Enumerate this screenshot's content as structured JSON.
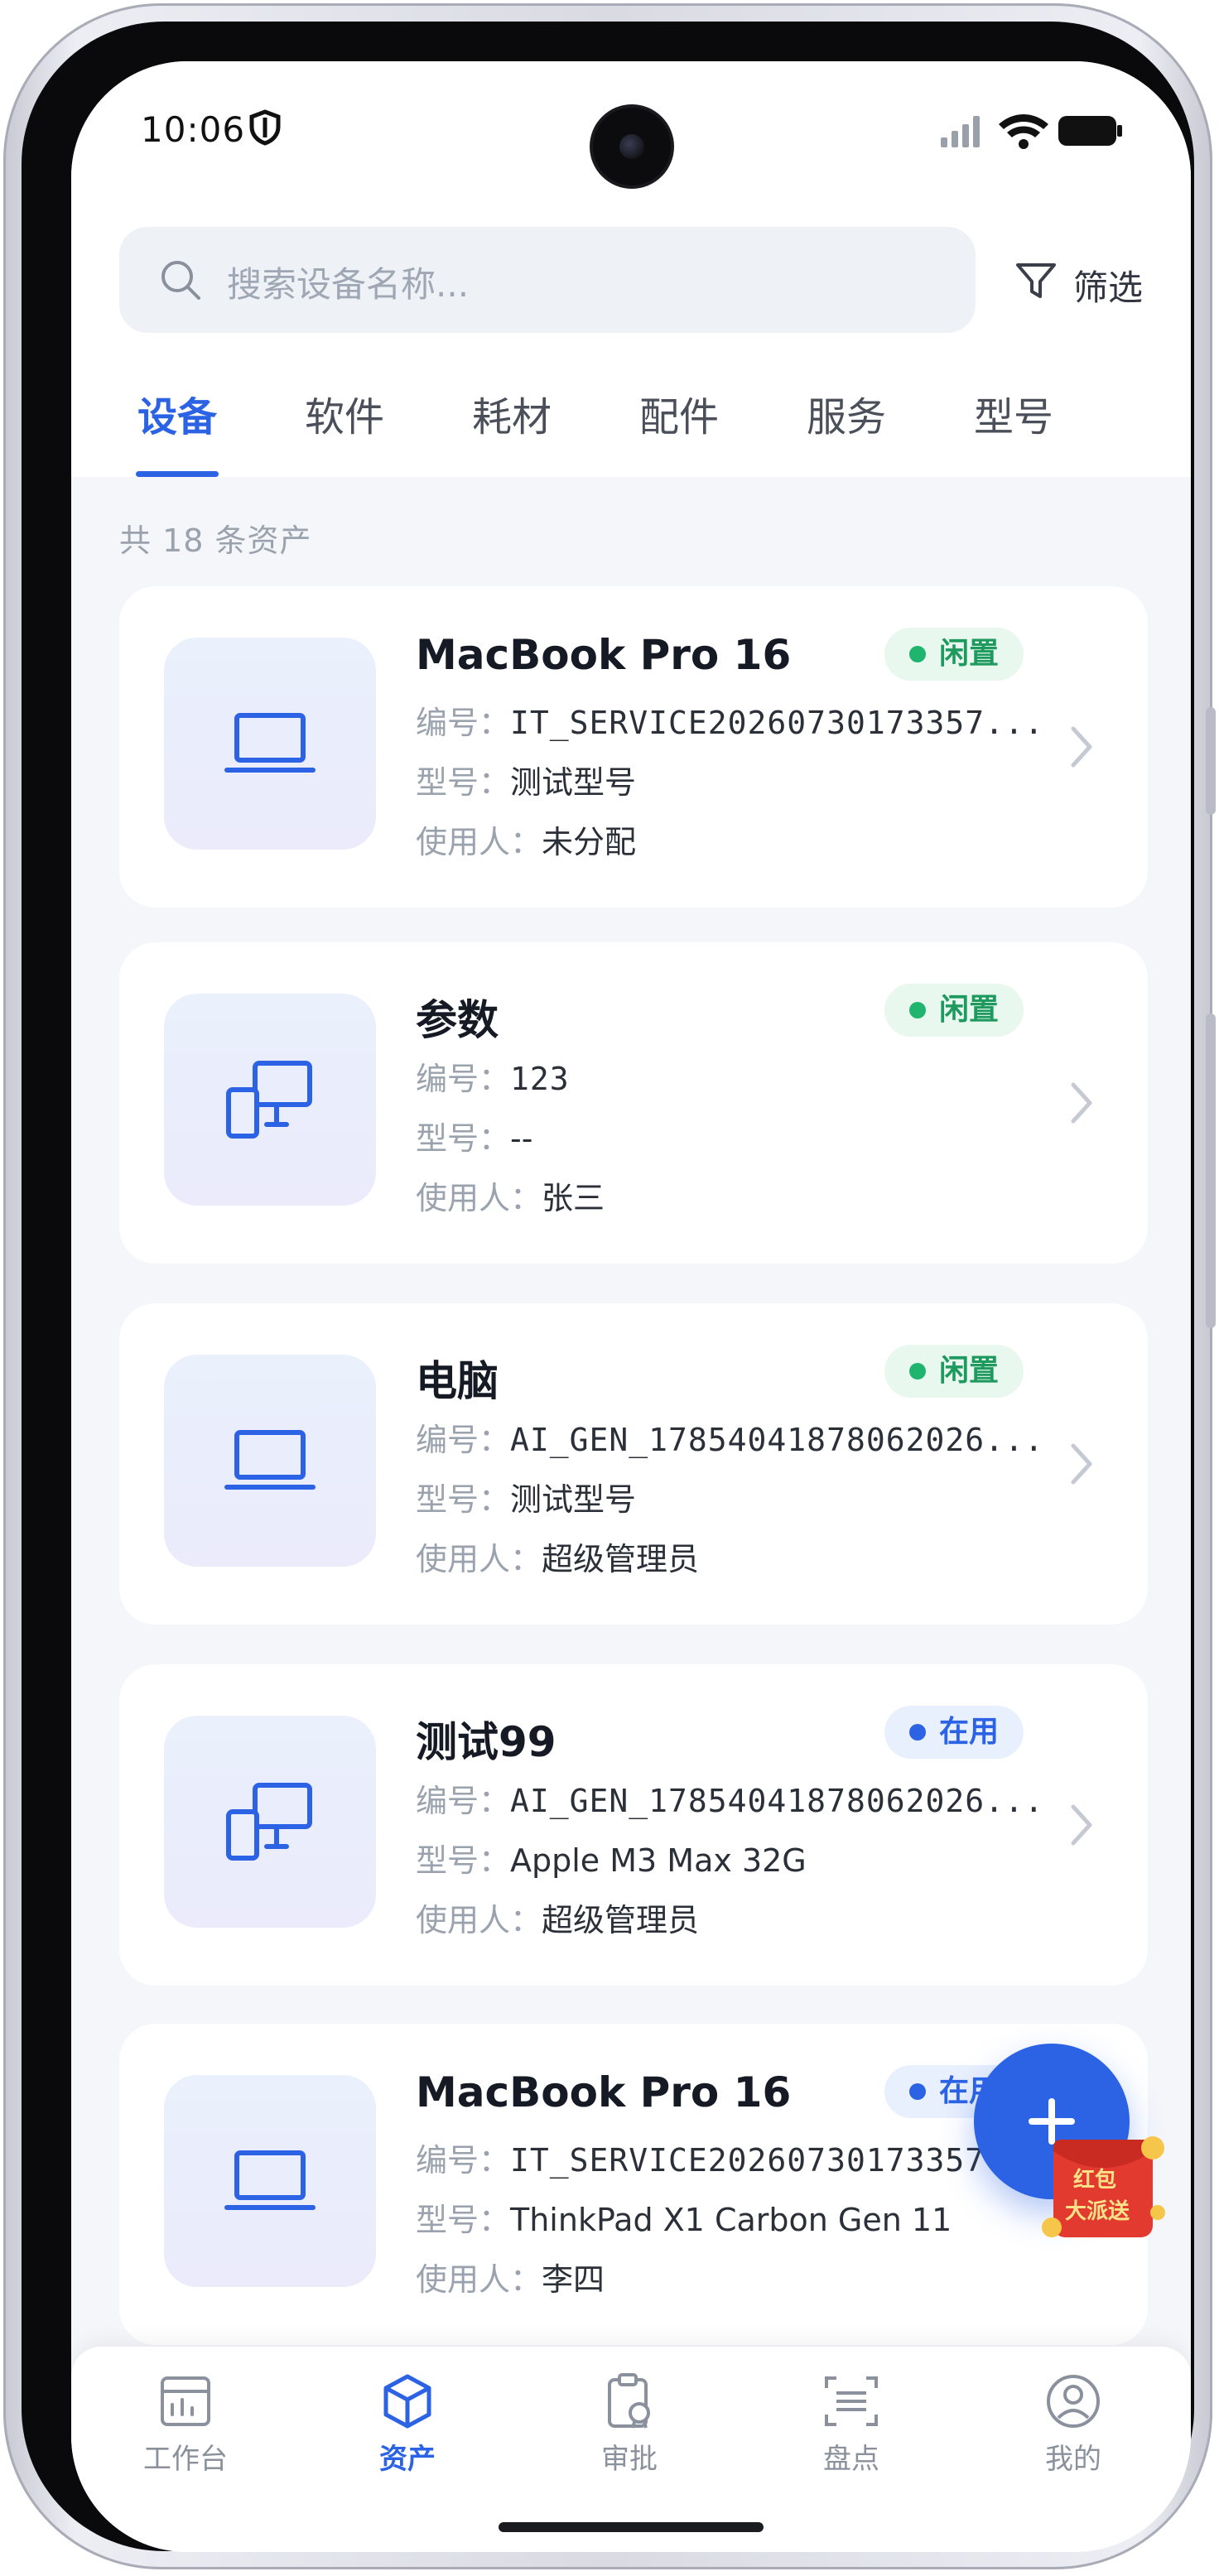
{
  "status_bar": {
    "time": "10:06"
  },
  "search": {
    "placeholder": "搜索设备名称..."
  },
  "filter": {
    "label": "筛选"
  },
  "tabs": [
    {
      "label": "设备",
      "active": true
    },
    {
      "label": "软件",
      "active": false
    },
    {
      "label": "耗材",
      "active": false
    },
    {
      "label": "配件",
      "active": false
    },
    {
      "label": "服务",
      "active": false
    },
    {
      "label": "型号",
      "active": false
    }
  ],
  "list": {
    "count_text": "共 18 条资产",
    "field_labels": {
      "code": "编号：",
      "model": "型号：",
      "user": "使用人："
    },
    "items": [
      {
        "icon": "laptop-icon",
        "name": "MacBook Pro 16",
        "status": "闲置",
        "status_type": "idle",
        "code": "IT_SERVICE20260730173357...",
        "model": "测试型号",
        "user": "未分配"
      },
      {
        "icon": "devices-icon",
        "name": "参数",
        "status": "闲置",
        "status_type": "idle",
        "code": "123",
        "model": "--",
        "user": "张三"
      },
      {
        "icon": "laptop-icon",
        "name": "电脑",
        "status": "闲置",
        "status_type": "idle",
        "code": "AI_GEN_17854041878062026...",
        "model": "测试型号",
        "user": "超级管理员"
      },
      {
        "icon": "devices-icon",
        "name": "测试99",
        "status": "在用",
        "status_type": "inuse",
        "code": "AI_GEN_17854041878062026...",
        "model": "Apple M3 Max 32G",
        "user": "超级管理员"
      },
      {
        "icon": "laptop-icon",
        "name": "MacBook Pro 16",
        "status": "在用",
        "status_type": "inuse",
        "code": "IT_SERVICE20260730173357",
        "model": "ThinkPad X1 Carbon Gen 11",
        "user": "李四"
      }
    ]
  },
  "promo": {
    "line1": "红包",
    "line2": "大派送"
  },
  "bottom_nav": [
    {
      "label": "工作台",
      "icon": "dashboard-icon",
      "active": false
    },
    {
      "label": "资产",
      "icon": "cube-icon",
      "active": true
    },
    {
      "label": "审批",
      "icon": "approval-icon",
      "active": false
    },
    {
      "label": "盘点",
      "icon": "scan-icon",
      "active": false
    },
    {
      "label": "我的",
      "icon": "user-icon",
      "active": false
    }
  ],
  "colors": {
    "accent": "#2b63e4",
    "idle_green": "#1f9a5e",
    "background": "#f4f6fa"
  }
}
